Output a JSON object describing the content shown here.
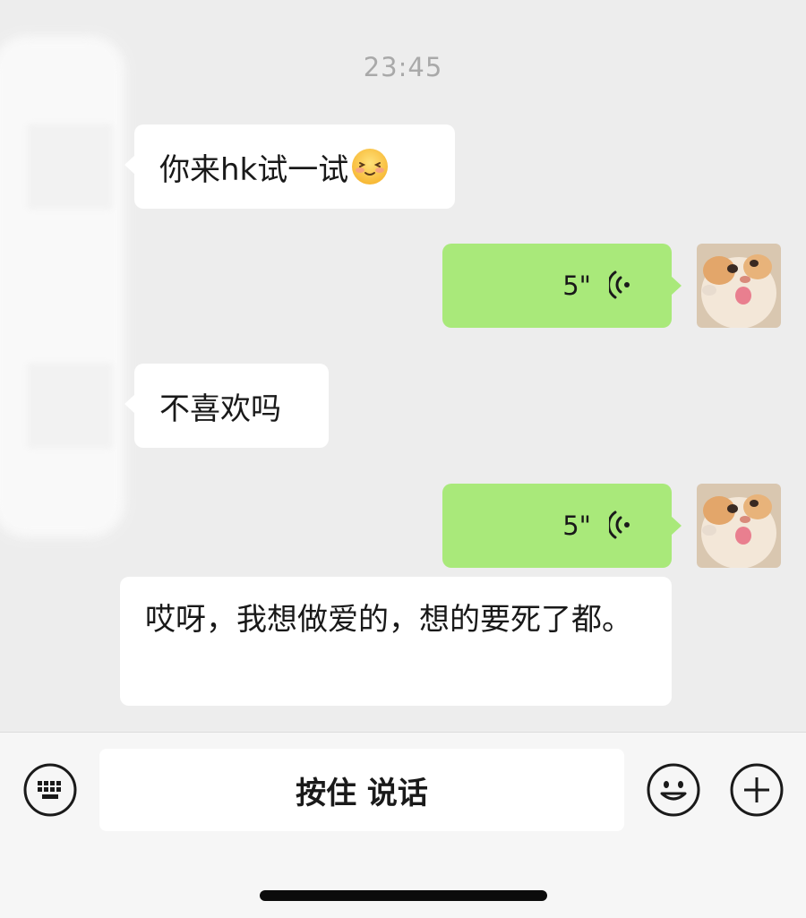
{
  "chat": {
    "timestamp": "23:45",
    "messages": [
      {
        "side": "incoming",
        "type": "text",
        "text": "你来hk试一试",
        "emoji": "blushing-face-emoji"
      },
      {
        "side": "outgoing",
        "type": "voice",
        "duration": "5\""
      },
      {
        "side": "incoming",
        "type": "text",
        "text": "不喜欢吗"
      },
      {
        "side": "outgoing",
        "type": "voice",
        "duration": "5\""
      },
      {
        "side": "incoming",
        "type": "text",
        "text": "哎呀，我想做爱的，想的要死了都。"
      }
    ]
  },
  "input_bar": {
    "hold_to_talk_label": "按住 说话",
    "icons": [
      "keyboard-icon",
      "emoji-icon",
      "plus-icon"
    ]
  },
  "colors": {
    "chat_background": "#ededed",
    "incoming_bubble": "#ffffff",
    "outgoing_bubble": "#a9e97a",
    "input_bar_background": "#f6f6f6"
  }
}
